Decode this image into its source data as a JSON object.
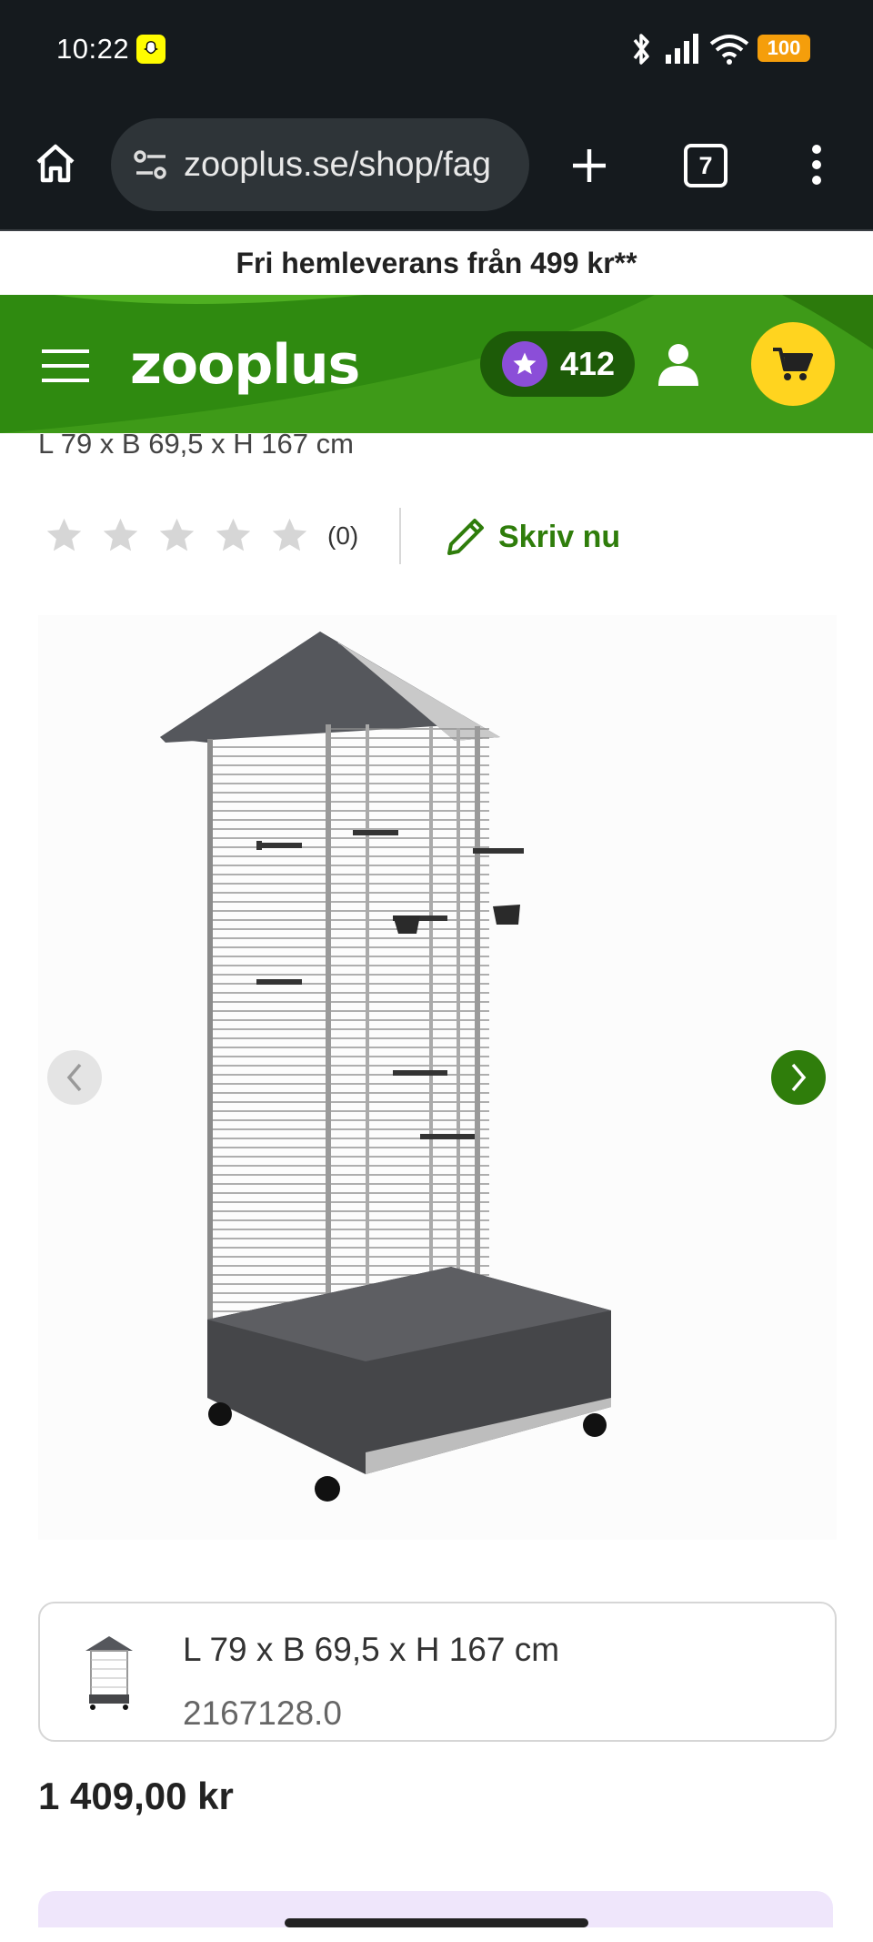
{
  "status_bar": {
    "time": "10:22",
    "battery": "100"
  },
  "browser": {
    "url": "zooplus.se/shop/fag",
    "tab_count": "7"
  },
  "promo": {
    "text": "Fri hemleverans från 499 kr**"
  },
  "header": {
    "logo": "zooplus",
    "points": "412"
  },
  "product": {
    "dimensions_top": "L 79 x B 69,5 x H 167 cm",
    "rating_count": "(0)",
    "rating_stars": 0,
    "write_review": "Skriv nu",
    "variant": {
      "name": "L 79 x B 69,5 x H 167 cm",
      "id": "2167128.0"
    },
    "price": "1 409,00 kr"
  },
  "colors": {
    "brand_green": "#3e9a18",
    "cart_yellow": "#ffd41f",
    "points_purple": "#8b4ed8",
    "text_green": "#2f7d0b"
  }
}
